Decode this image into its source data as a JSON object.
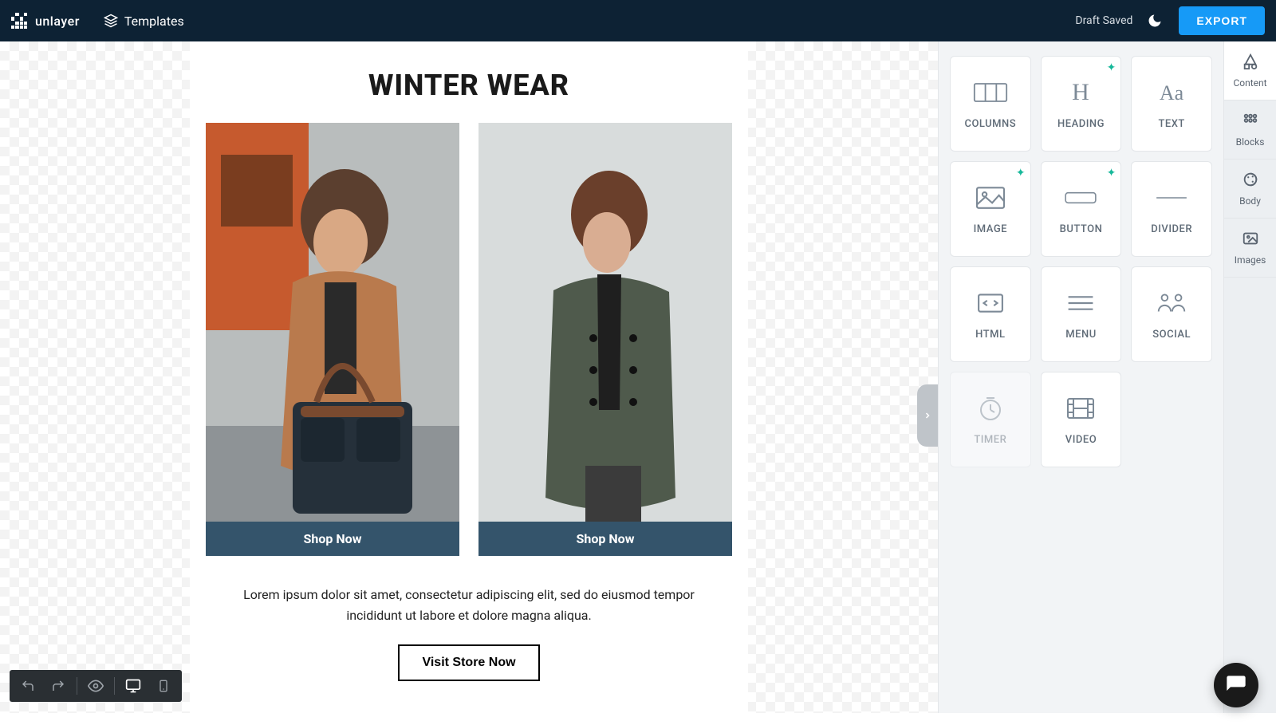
{
  "header": {
    "brand": "unlayer",
    "templates_label": "Templates",
    "draft_saved": "Draft Saved",
    "export_label": "EXPORT"
  },
  "canvas": {
    "title": "WINTER WEAR",
    "products": [
      {
        "cta": "Shop Now"
      },
      {
        "cta": "Shop Now"
      }
    ],
    "lorem": "Lorem ipsum dolor sit amet, consectetur adipiscing elit, sed do eiusmod tempor incididunt ut labore et dolore magna aliqua.",
    "visit_label": "Visit Store Now"
  },
  "tools": [
    {
      "key": "columns",
      "label": "COLUMNS",
      "ai": false
    },
    {
      "key": "heading",
      "label": "HEADING",
      "ai": true
    },
    {
      "key": "text",
      "label": "TEXT",
      "ai": false
    },
    {
      "key": "image",
      "label": "IMAGE",
      "ai": true
    },
    {
      "key": "button",
      "label": "BUTTON",
      "ai": true
    },
    {
      "key": "divider",
      "label": "DIVIDER",
      "ai": false
    },
    {
      "key": "html",
      "label": "HTML",
      "ai": false
    },
    {
      "key": "menu",
      "label": "MENU",
      "ai": false
    },
    {
      "key": "social",
      "label": "SOCIAL",
      "ai": false
    },
    {
      "key": "timer",
      "label": "TIMER",
      "ai": false,
      "disabled": true
    },
    {
      "key": "video",
      "label": "VIDEO",
      "ai": false
    }
  ],
  "side_tabs": [
    {
      "key": "content",
      "label": "Content",
      "active": true
    },
    {
      "key": "blocks",
      "label": "Blocks"
    },
    {
      "key": "body",
      "label": "Body"
    },
    {
      "key": "images",
      "label": "Images"
    }
  ]
}
